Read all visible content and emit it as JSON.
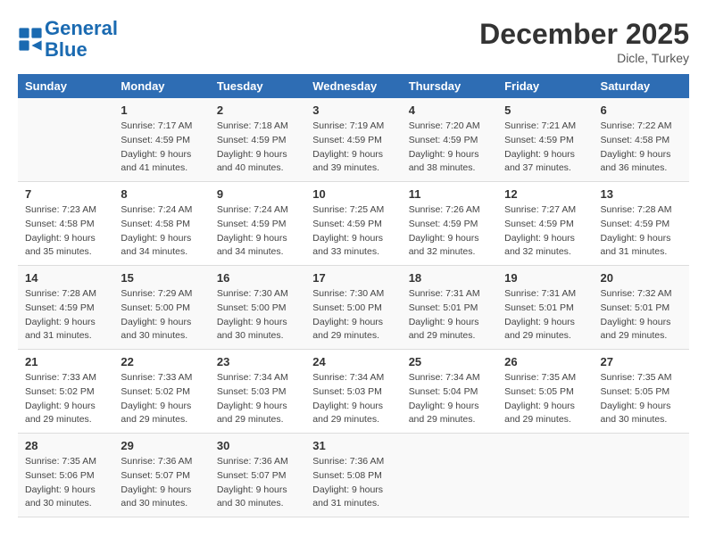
{
  "logo": {
    "line1": "General",
    "line2": "Blue"
  },
  "title": "December 2025",
  "location": "Dicle, Turkey",
  "days_of_week": [
    "Sunday",
    "Monday",
    "Tuesday",
    "Wednesday",
    "Thursday",
    "Friday",
    "Saturday"
  ],
  "weeks": [
    [
      {
        "num": "",
        "info": ""
      },
      {
        "num": "1",
        "info": "Sunrise: 7:17 AM\nSunset: 4:59 PM\nDaylight: 9 hours\nand 41 minutes."
      },
      {
        "num": "2",
        "info": "Sunrise: 7:18 AM\nSunset: 4:59 PM\nDaylight: 9 hours\nand 40 minutes."
      },
      {
        "num": "3",
        "info": "Sunrise: 7:19 AM\nSunset: 4:59 PM\nDaylight: 9 hours\nand 39 minutes."
      },
      {
        "num": "4",
        "info": "Sunrise: 7:20 AM\nSunset: 4:59 PM\nDaylight: 9 hours\nand 38 minutes."
      },
      {
        "num": "5",
        "info": "Sunrise: 7:21 AM\nSunset: 4:59 PM\nDaylight: 9 hours\nand 37 minutes."
      },
      {
        "num": "6",
        "info": "Sunrise: 7:22 AM\nSunset: 4:58 PM\nDaylight: 9 hours\nand 36 minutes."
      }
    ],
    [
      {
        "num": "7",
        "info": "Sunrise: 7:23 AM\nSunset: 4:58 PM\nDaylight: 9 hours\nand 35 minutes."
      },
      {
        "num": "8",
        "info": "Sunrise: 7:24 AM\nSunset: 4:58 PM\nDaylight: 9 hours\nand 34 minutes."
      },
      {
        "num": "9",
        "info": "Sunrise: 7:24 AM\nSunset: 4:59 PM\nDaylight: 9 hours\nand 34 minutes."
      },
      {
        "num": "10",
        "info": "Sunrise: 7:25 AM\nSunset: 4:59 PM\nDaylight: 9 hours\nand 33 minutes."
      },
      {
        "num": "11",
        "info": "Sunrise: 7:26 AM\nSunset: 4:59 PM\nDaylight: 9 hours\nand 32 minutes."
      },
      {
        "num": "12",
        "info": "Sunrise: 7:27 AM\nSunset: 4:59 PM\nDaylight: 9 hours\nand 32 minutes."
      },
      {
        "num": "13",
        "info": "Sunrise: 7:28 AM\nSunset: 4:59 PM\nDaylight: 9 hours\nand 31 minutes."
      }
    ],
    [
      {
        "num": "14",
        "info": "Sunrise: 7:28 AM\nSunset: 4:59 PM\nDaylight: 9 hours\nand 31 minutes."
      },
      {
        "num": "15",
        "info": "Sunrise: 7:29 AM\nSunset: 5:00 PM\nDaylight: 9 hours\nand 30 minutes."
      },
      {
        "num": "16",
        "info": "Sunrise: 7:30 AM\nSunset: 5:00 PM\nDaylight: 9 hours\nand 30 minutes."
      },
      {
        "num": "17",
        "info": "Sunrise: 7:30 AM\nSunset: 5:00 PM\nDaylight: 9 hours\nand 29 minutes."
      },
      {
        "num": "18",
        "info": "Sunrise: 7:31 AM\nSunset: 5:01 PM\nDaylight: 9 hours\nand 29 minutes."
      },
      {
        "num": "19",
        "info": "Sunrise: 7:31 AM\nSunset: 5:01 PM\nDaylight: 9 hours\nand 29 minutes."
      },
      {
        "num": "20",
        "info": "Sunrise: 7:32 AM\nSunset: 5:01 PM\nDaylight: 9 hours\nand 29 minutes."
      }
    ],
    [
      {
        "num": "21",
        "info": "Sunrise: 7:33 AM\nSunset: 5:02 PM\nDaylight: 9 hours\nand 29 minutes."
      },
      {
        "num": "22",
        "info": "Sunrise: 7:33 AM\nSunset: 5:02 PM\nDaylight: 9 hours\nand 29 minutes."
      },
      {
        "num": "23",
        "info": "Sunrise: 7:34 AM\nSunset: 5:03 PM\nDaylight: 9 hours\nand 29 minutes."
      },
      {
        "num": "24",
        "info": "Sunrise: 7:34 AM\nSunset: 5:03 PM\nDaylight: 9 hours\nand 29 minutes."
      },
      {
        "num": "25",
        "info": "Sunrise: 7:34 AM\nSunset: 5:04 PM\nDaylight: 9 hours\nand 29 minutes."
      },
      {
        "num": "26",
        "info": "Sunrise: 7:35 AM\nSunset: 5:05 PM\nDaylight: 9 hours\nand 29 minutes."
      },
      {
        "num": "27",
        "info": "Sunrise: 7:35 AM\nSunset: 5:05 PM\nDaylight: 9 hours\nand 30 minutes."
      }
    ],
    [
      {
        "num": "28",
        "info": "Sunrise: 7:35 AM\nSunset: 5:06 PM\nDaylight: 9 hours\nand 30 minutes."
      },
      {
        "num": "29",
        "info": "Sunrise: 7:36 AM\nSunset: 5:07 PM\nDaylight: 9 hours\nand 30 minutes."
      },
      {
        "num": "30",
        "info": "Sunrise: 7:36 AM\nSunset: 5:07 PM\nDaylight: 9 hours\nand 30 minutes."
      },
      {
        "num": "31",
        "info": "Sunrise: 7:36 AM\nSunset: 5:08 PM\nDaylight: 9 hours\nand 31 minutes."
      },
      {
        "num": "",
        "info": ""
      },
      {
        "num": "",
        "info": ""
      },
      {
        "num": "",
        "info": ""
      }
    ]
  ]
}
